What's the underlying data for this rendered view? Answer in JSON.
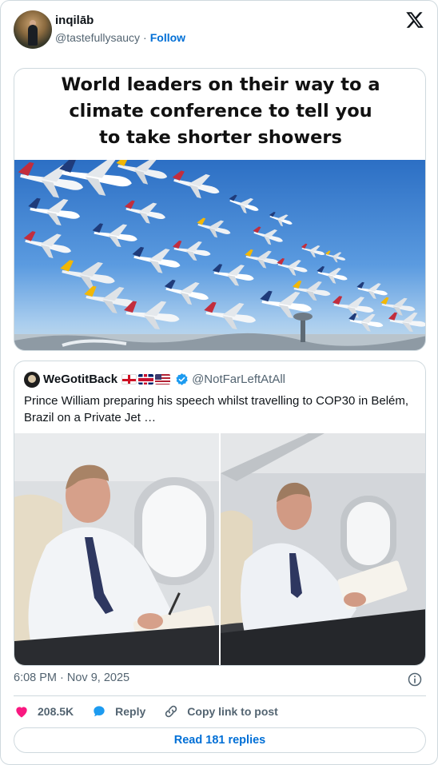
{
  "author": {
    "display_name": "inqilāb",
    "handle": "@tastefullysaucy",
    "separator": "·",
    "follow_label": "Follow"
  },
  "media": {
    "caption_lines": [
      "World leaders on their way to a",
      "climate conference to tell you",
      "to take shorter showers"
    ]
  },
  "quoted_post": {
    "display_name": "WeGotitBack",
    "handle": "@NotFarLeftAtAll",
    "text": "Prince William preparing his speech whilst travelling to COP30 in Belém, Brazil on a Private Jet …",
    "flags": [
      "flag-england",
      "flag-united-kingdom",
      "flag-united-states"
    ]
  },
  "meta": {
    "timestamp": "6:08 PM · Nov 9, 2025"
  },
  "actions": {
    "likes": "208.5K",
    "reply_label": "Reply",
    "copy_link_label": "Copy link to post",
    "read_replies_label": "Read 181 replies"
  },
  "colors": {
    "accent_link": "#006fd6",
    "like_pink": "#f91880",
    "reply_blue": "#1d9bf0",
    "secondary_text": "#536471",
    "border": "#cfd9de"
  },
  "icons": [
    "x-logo-icon",
    "verified-badge-icon",
    "info-icon",
    "heart-icon",
    "reply-bubble-icon",
    "link-icon"
  ]
}
